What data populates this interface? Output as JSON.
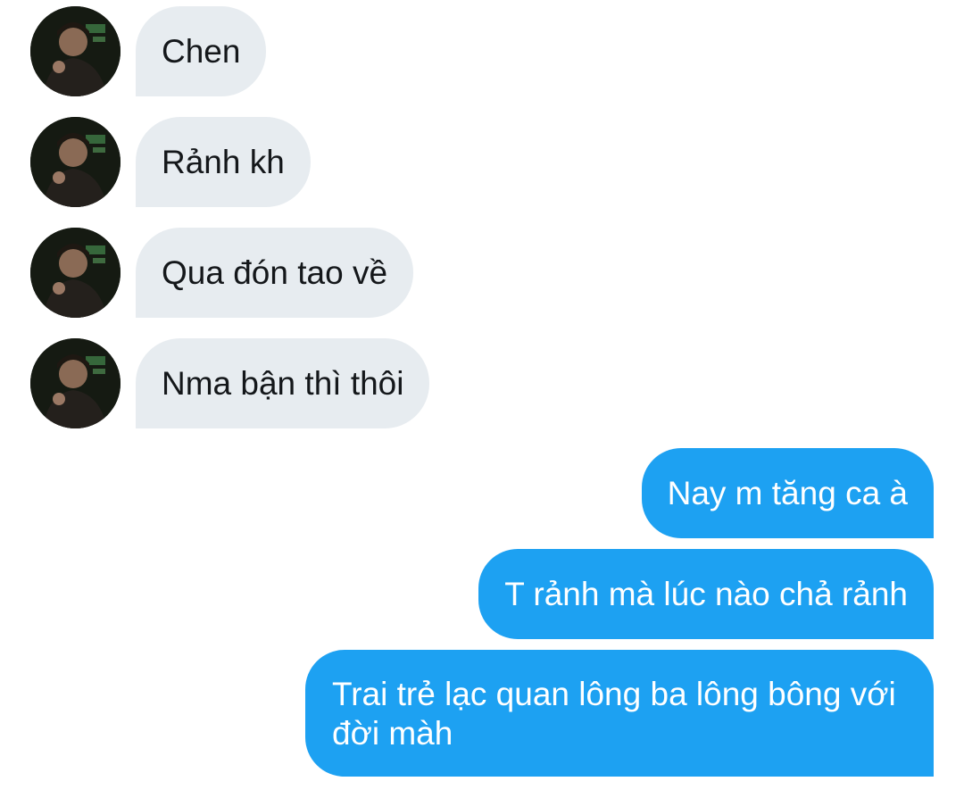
{
  "conversation": {
    "contact_avatar_icon": "contact-avatar-icon",
    "incoming": [
      {
        "text": "Chen"
      },
      {
        "text": "Rảnh kh"
      },
      {
        "text": "Qua đón tao về"
      },
      {
        "text": "Nma bận thì thôi"
      }
    ],
    "outgoing": [
      {
        "text": "Nay m tăng ca à"
      },
      {
        "text": "T rảnh mà lúc nào chả rảnh"
      },
      {
        "text": "Trai trẻ lạc quan lông ba lông bông với đời màh"
      }
    ]
  },
  "colors": {
    "background": "#ffffff",
    "incoming_bubble": "#e7ecf0",
    "incoming_text": "#14171a",
    "outgoing_bubble": "#1da1f2",
    "outgoing_text": "#ffffff"
  }
}
